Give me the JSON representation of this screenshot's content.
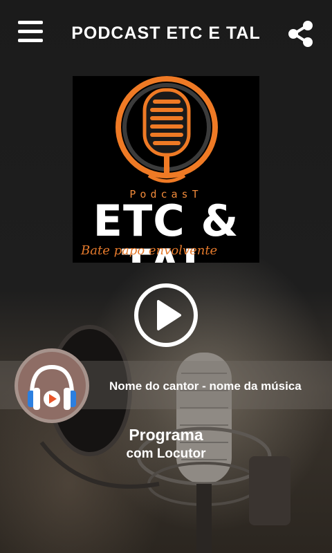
{
  "header": {
    "title": "PODCAST ETC E TAL",
    "menu_icon": "hamburger-menu-icon",
    "share_icon": "share-icon"
  },
  "logo": {
    "small_text": "PodcasT",
    "main_text": "ETC & TAL",
    "tagline": "Bate papo envolvente",
    "accent_color": "#f08a3a"
  },
  "player": {
    "play_icon": "play-icon",
    "now_playing": "Nome do cantor - nome da música",
    "cover_icon": "headphones-icon"
  },
  "program": {
    "title": "Programa",
    "host": "com Locutor"
  }
}
